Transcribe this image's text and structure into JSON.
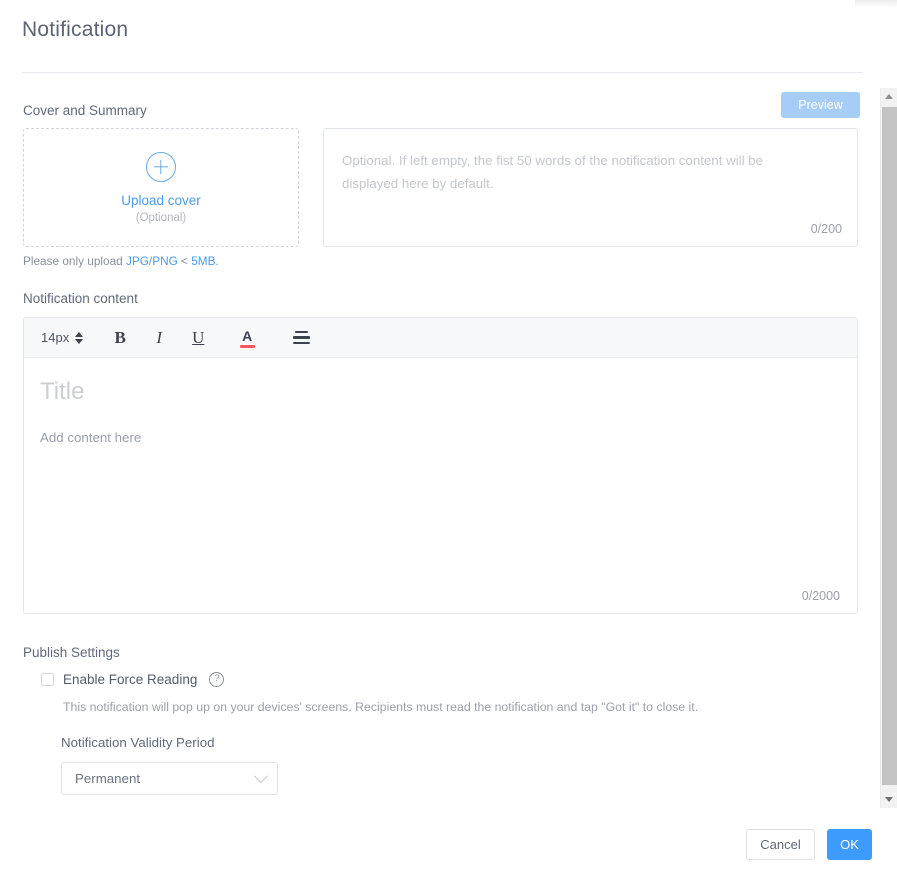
{
  "header": {
    "title": "Notification"
  },
  "cover_section": {
    "label": "Cover and Summary",
    "preview_button": "Preview",
    "upload": {
      "plus_icon": "plus-circle-icon",
      "label": "Upload cover",
      "optional": "(Optional)"
    },
    "hint": {
      "prefix": "Please only upload ",
      "formats": "JPG/PNG",
      "middle": " < ",
      "size": "5MB",
      "suffix": "."
    },
    "summary": {
      "placeholder": "Optional. If left empty, the fist 50 words of the notification content will be displayed here by default.",
      "value": "",
      "counter": "0/200"
    }
  },
  "content_section": {
    "label": "Notification content",
    "toolbar": {
      "font_size": "14px",
      "stepper_icon": "stepper-updown-icon",
      "bold": "B",
      "italic": "I",
      "underline": "U",
      "text_color": "A",
      "text_color_swatch": "#f9555a",
      "align": "align-icon"
    },
    "editor": {
      "title_placeholder": "Title",
      "title_value": "",
      "content_placeholder": "Add content here",
      "content_value": "",
      "counter": "0/2000"
    }
  },
  "publish_section": {
    "label": "Publish Settings",
    "force_reading": {
      "checked": false,
      "label": "Enable Force Reading",
      "help_icon": "question-mark-icon",
      "help_glyph": "?",
      "description": "This notification will pop up on your devices' screens. Recipients must read the notification and tap \"Got it\" to close it."
    },
    "validity": {
      "label": "Notification Validity Period",
      "selected": "Permanent",
      "chevron_icon": "chevron-down-icon"
    }
  },
  "footer": {
    "cancel": "Cancel",
    "ok": "OK"
  },
  "scrollbar": {
    "up_icon": "scroll-up-arrow-icon",
    "down_icon": "scroll-down-arrow-icon"
  },
  "colors": {
    "accent": "#3d9bfc",
    "accent_muted": "#a5cdf5",
    "link": "#4d9bec",
    "text": "#5a6474",
    "muted": "#9aa0aa",
    "border": "#e3e6eb"
  }
}
